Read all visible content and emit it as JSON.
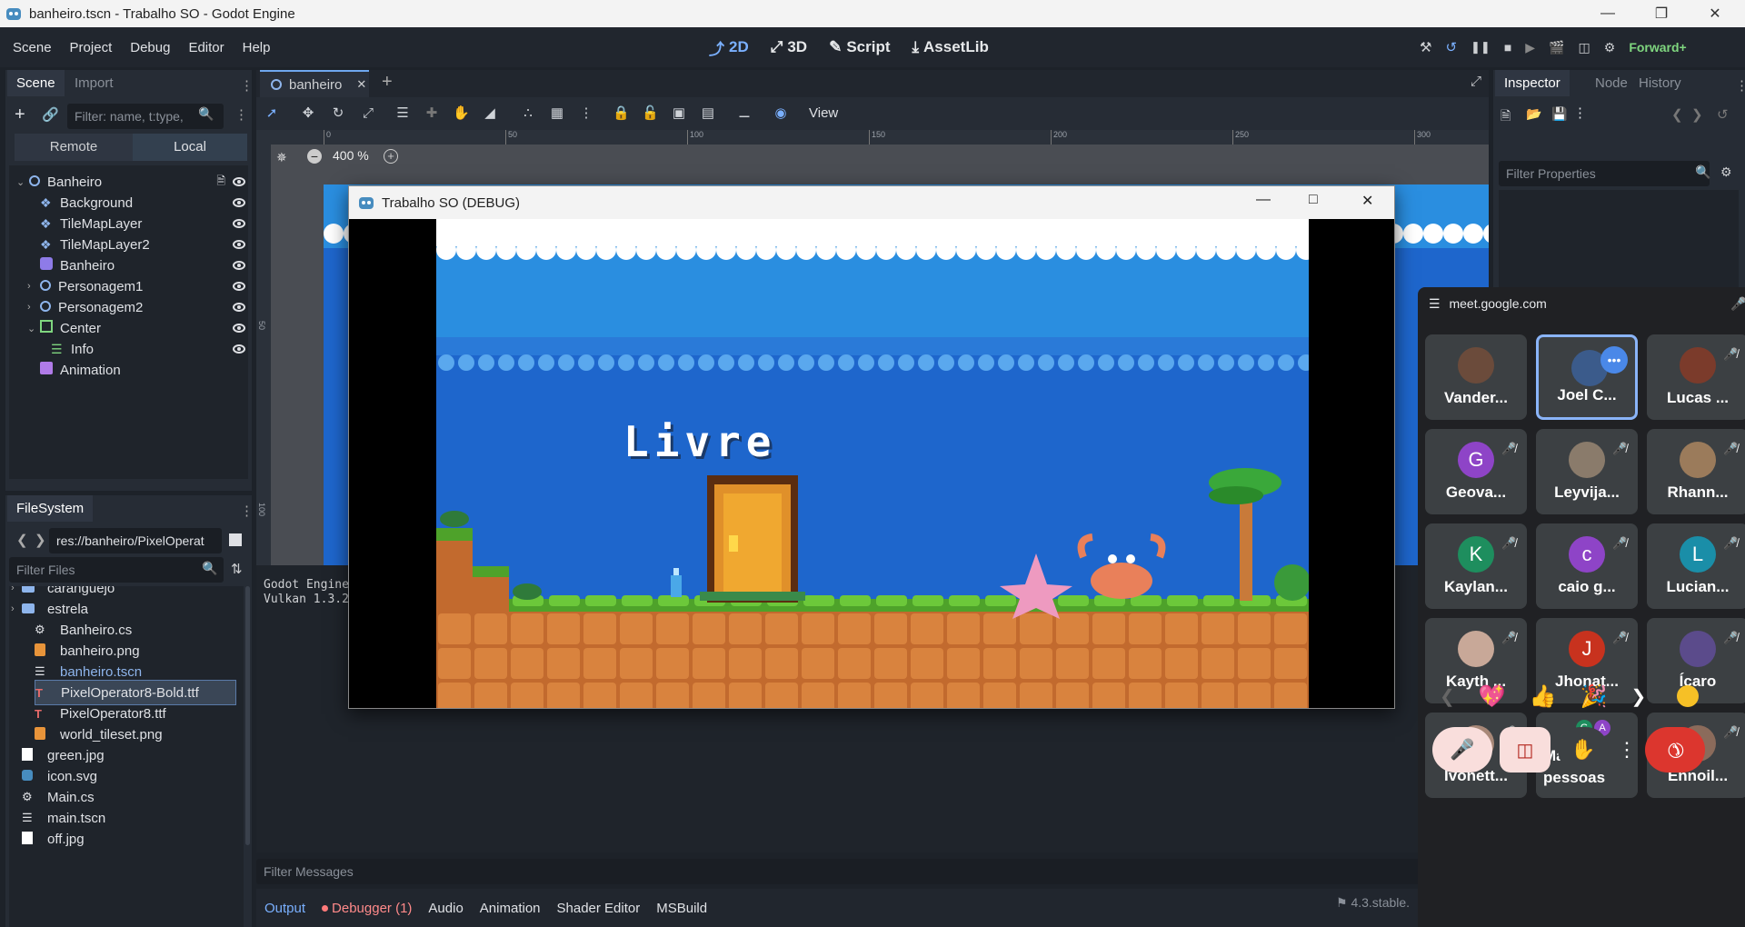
{
  "window": {
    "title": "banheiro.tscn - Trabalho SO - Godot Engine"
  },
  "menu": [
    "Scene",
    "Project",
    "Debug",
    "Editor",
    "Help"
  ],
  "main_tabs": [
    {
      "label": "2D",
      "icon": "2d-icon",
      "active": true
    },
    {
      "label": "3D",
      "icon": "3d-icon",
      "active": false
    },
    {
      "label": "Script",
      "icon": "script-icon",
      "active": false
    },
    {
      "label": "AssetLib",
      "icon": "assetlib-icon",
      "active": false
    }
  ],
  "renderer": "Forward+",
  "scene_dock": {
    "tabs": [
      "Scene",
      "Import"
    ],
    "filter_placeholder": "Filter: name, t:type,",
    "mode_tabs": [
      "Remote",
      "Local"
    ],
    "nodes": [
      {
        "name": "Banheiro",
        "type": "node2d",
        "indent": 0,
        "expander": "v",
        "has_script": true,
        "visible_eye": true
      },
      {
        "name": "Background",
        "type": "sprite",
        "indent": 1,
        "expander": "",
        "has_script": false,
        "visible_eye": true
      },
      {
        "name": "TileMapLayer",
        "type": "sprite",
        "indent": 1,
        "expander": "",
        "has_script": false,
        "visible_eye": true
      },
      {
        "name": "TileMapLayer2",
        "type": "sprite",
        "indent": 1,
        "expander": "",
        "has_script": false,
        "visible_eye": true
      },
      {
        "name": "Banheiro",
        "type": "sprite-anim",
        "indent": 1,
        "expander": "",
        "has_script": false,
        "visible_eye": true
      },
      {
        "name": "Personagem1",
        "type": "node2d",
        "indent": 1,
        "expander": ">",
        "has_script": false,
        "visible_eye": true
      },
      {
        "name": "Personagem2",
        "type": "node2d",
        "indent": 1,
        "expander": ">",
        "has_script": false,
        "visible_eye": true
      },
      {
        "name": "Center",
        "type": "control",
        "indent": 1,
        "expander": "v",
        "has_script": false,
        "visible_eye": true
      },
      {
        "name": "Info",
        "type": "label",
        "indent": 2,
        "expander": "",
        "has_script": false,
        "visible_eye": true
      },
      {
        "name": "Animation",
        "type": "animation",
        "indent": 1,
        "expander": "",
        "has_script": false,
        "visible_eye": false
      }
    ]
  },
  "filesystem": {
    "title": "FileSystem",
    "path": "res://banheiro/PixelOperat",
    "filter_placeholder": "Filter Files",
    "items": [
      {
        "name": "caranguejo",
        "icon": "folder",
        "indent": 1
      },
      {
        "name": "estrela",
        "icon": "folder",
        "indent": 1
      },
      {
        "name": "Banheiro.cs",
        "icon": "gear",
        "indent": 2
      },
      {
        "name": "banheiro.png",
        "icon": "image",
        "indent": 2
      },
      {
        "name": "banheiro.tscn",
        "icon": "scene",
        "indent": 2
      },
      {
        "name": "PixelOperator8-Bold.ttf",
        "icon": "font",
        "indent": 2
      },
      {
        "name": "PixelOperator8.ttf",
        "icon": "font",
        "indent": 2
      },
      {
        "name": "world_tileset.png",
        "icon": "image",
        "indent": 2
      },
      {
        "name": "green.jpg",
        "icon": "file",
        "indent": 1
      },
      {
        "name": "icon.svg",
        "icon": "godot",
        "indent": 1
      },
      {
        "name": "Main.cs",
        "icon": "gear",
        "indent": 1
      },
      {
        "name": "main.tscn",
        "icon": "scene",
        "indent": 1
      },
      {
        "name": "off.jpg",
        "icon": "file",
        "indent": 1
      }
    ]
  },
  "editor": {
    "scene_tab": "banheiro",
    "view_label": "View",
    "zoom": "400 %",
    "ruler_ticks": [
      "0",
      "50",
      "100",
      "150",
      "200",
      "250",
      "300"
    ],
    "vruler_ticks": [
      "50",
      "100"
    ]
  },
  "output": {
    "lines": [
      "Godot Engine",
      "Vulkan 1.3.2"
    ],
    "filter_placeholder": "Filter Messages",
    "tabs": [
      "Output",
      "Debugger (1)",
      "Audio",
      "Animation",
      "Shader Editor",
      "MSBuild"
    ],
    "version": "4.3.stable."
  },
  "inspector": {
    "tabs": [
      "Inspector",
      "Node",
      "History"
    ],
    "filter_placeholder": "Filter Properties"
  },
  "game_window": {
    "title": "Trabalho SO (DEBUG)",
    "status_text": "Livre"
  },
  "meet": {
    "url": "meet.google.com",
    "participants": [
      {
        "name": "Vander...",
        "initial": "",
        "avatar_color": "#6b4b3b",
        "muted": false
      },
      {
        "name": "Joel C...",
        "initial": "",
        "avatar_color": "#3b5b8b",
        "muted": false,
        "active": true
      },
      {
        "name": "Lucas ...",
        "initial": "",
        "avatar_color": "#7b3b2b",
        "muted": true
      },
      {
        "name": "Geova...",
        "initial": "G",
        "avatar_color": "#8e44c7",
        "muted": true
      },
      {
        "name": "Leyvija...",
        "initial": "",
        "avatar_color": "#8a7b6b",
        "muted": true
      },
      {
        "name": "Rhann...",
        "initial": "",
        "avatar_color": "#9b7b5b",
        "muted": true
      },
      {
        "name": "Kaylan...",
        "initial": "K",
        "avatar_color": "#1e8e5e",
        "muted": true
      },
      {
        "name": "caio g...",
        "initial": "c",
        "avatar_color": "#8e44c7",
        "muted": true
      },
      {
        "name": "Lucian...",
        "initial": "L",
        "avatar_color": "#1a8ea8",
        "muted": true
      },
      {
        "name": "Kayth ...",
        "initial": "",
        "avatar_color": "#c8a898",
        "muted": true
      },
      {
        "name": "Jhonat...",
        "initial": "J",
        "avatar_color": "#c8321e",
        "muted": true
      },
      {
        "name": "Ícaro",
        "initial": "",
        "avatar_color": "#5b4b8b",
        "muted": true
      },
      {
        "name": "Ivonett...",
        "initial": "",
        "avatar_color": "#a88878",
        "muted": true
      },
      {
        "name": "Mais 9 pessoas",
        "initial": "",
        "avatar_color": "",
        "muted": false,
        "more": true
      },
      {
        "name": "Ennoil...",
        "initial": "",
        "avatar_color": "#8b6b5b",
        "muted": true
      }
    ],
    "more_badges": [
      "G",
      "A"
    ],
    "reactions": [
      "💖",
      "👍",
      "🎉"
    ]
  }
}
